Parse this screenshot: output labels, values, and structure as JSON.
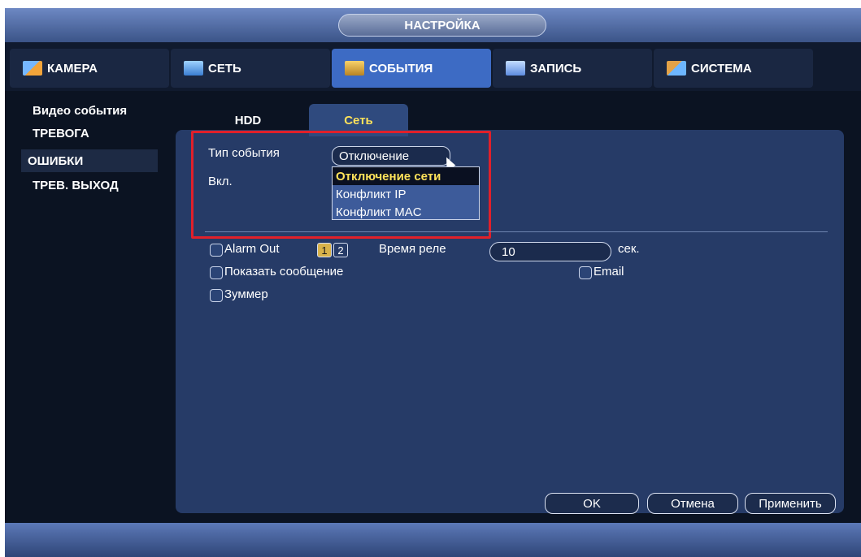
{
  "window": {
    "title": "НАСТРОЙКА"
  },
  "main_tabs": [
    {
      "label": "КАМЕРА",
      "icon": "camera-icon"
    },
    {
      "label": "СЕТЬ",
      "icon": "network-icon"
    },
    {
      "label": "СОБЫТИЯ",
      "icon": "events-icon",
      "active": true
    },
    {
      "label": "ЗАПИСЬ",
      "icon": "record-icon"
    },
    {
      "label": "СИСТЕМА",
      "icon": "system-icon"
    }
  ],
  "sidebar": {
    "items": [
      {
        "label": "Видео события"
      },
      {
        "label": "ТРЕВОГА"
      },
      {
        "label": "ОШИБКИ",
        "active": true
      },
      {
        "label": "ТРЕВ. ВЫХОД"
      }
    ]
  },
  "sub_tabs": [
    {
      "label": "HDD"
    },
    {
      "label": "Сеть",
      "active": true
    }
  ],
  "form": {
    "event_type_label": "Тип события",
    "event_type_value": "Отключение",
    "enable_label": "Вкл.",
    "dropdown_options": [
      "Отключение сети",
      "Конфликт IP",
      "Конфликт MAC"
    ],
    "alarm_out_label": "Alarm Out",
    "alarm_out_channels": [
      "1",
      "2"
    ],
    "relay_time_label": "Время реле",
    "relay_time_value": "10",
    "relay_time_unit": "сек.",
    "show_message_label": "Показать сообщение",
    "email_label": "Email",
    "buzzer_label": "Зуммер"
  },
  "buttons": {
    "ok": "OK",
    "cancel": "Отмена",
    "apply": "Применить"
  },
  "colors": {
    "accent": "#3d6bc4",
    "highlight_box": "#e0202a",
    "selected_text": "#ffe25a"
  }
}
